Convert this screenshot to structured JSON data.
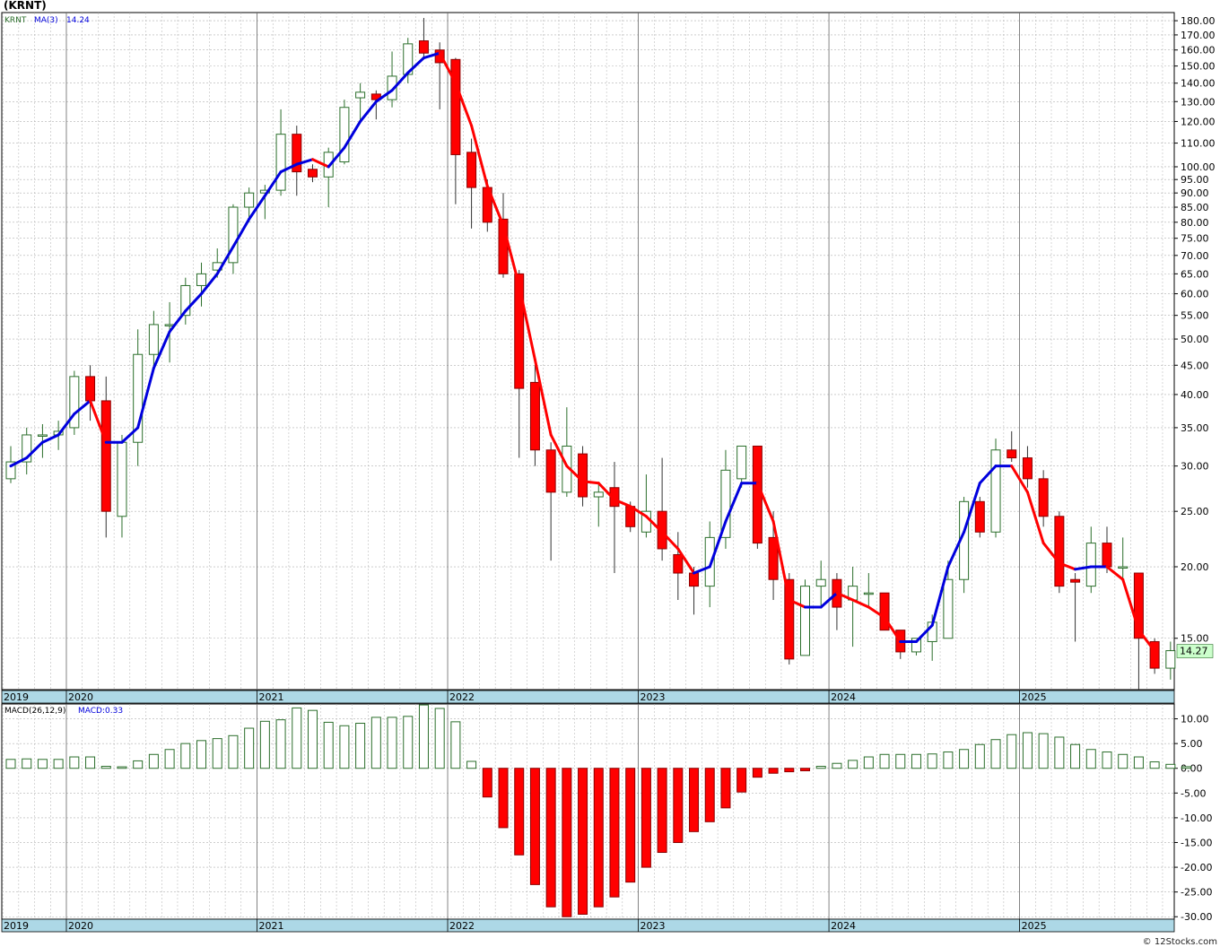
{
  "title": "(KRNT)",
  "credit": "© 12Stocks.com",
  "colors": {
    "up": "#2b6e2b",
    "down": "#ff0000",
    "ma_up": "#0000dd",
    "ma_down": "#ff0000",
    "axis_band": "#add8e6",
    "grid": "#b0b0b0"
  },
  "chart_data": [
    {
      "type": "candlestick",
      "legend": {
        "symbol": "KRNT",
        "ma_label": "MA(3)",
        "ma_value": "14.24"
      },
      "last_price_label": "14.27",
      "y_scale": "log",
      "y_ticks": [
        15,
        20,
        25,
        30,
        35,
        40,
        45,
        50,
        55,
        60,
        65,
        70,
        75,
        80,
        85,
        90,
        95,
        100,
        110,
        120,
        130,
        140,
        150,
        160,
        170,
        180
      ],
      "ylim": [
        12.2,
        186
      ],
      "x_labels": [
        "2019",
        "2020",
        "2021",
        "2022",
        "2023",
        "2024",
        "2025"
      ],
      "grid": true,
      "candles": [
        [
          28.5,
          30.5,
          32.5,
          28.0
        ],
        [
          30.5,
          34.0,
          35.0,
          29.0
        ],
        [
          34.0,
          34.0,
          35.5,
          31.0
        ],
        [
          34.0,
          34.5,
          36.0,
          32.0
        ],
        [
          35.0,
          43.0,
          44.0,
          34.0
        ],
        [
          43.0,
          39.0,
          45.0,
          36.0
        ],
        [
          39.0,
          25.0,
          43.0,
          22.5
        ],
        [
          24.5,
          33.0,
          34.0,
          22.5
        ],
        [
          33.0,
          47.0,
          52.0,
          30.0
        ],
        [
          47.0,
          53.0,
          56.0,
          44.0
        ],
        [
          53.0,
          53.0,
          58.0,
          45.5
        ],
        [
          55.0,
          62.0,
          64.0,
          53.0
        ],
        [
          62.0,
          65.0,
          68.0,
          57.0
        ],
        [
          66.0,
          68.0,
          72.0,
          64.0
        ],
        [
          68.0,
          85.0,
          86.0,
          65.0
        ],
        [
          85.0,
          90.0,
          92.0,
          80.0
        ],
        [
          90.0,
          91.0,
          93.0,
          81.0
        ],
        [
          91.0,
          114.0,
          126.0,
          89.0
        ],
        [
          114.0,
          98.0,
          118.0,
          89.0
        ],
        [
          99.0,
          96.0,
          101.0,
          94.0
        ],
        [
          96.0,
          106.0,
          108.0,
          85.0
        ],
        [
          102.0,
          127.0,
          131.0,
          101.0
        ],
        [
          132.0,
          135.0,
          140.0,
          120.0
        ],
        [
          134.0,
          131.0,
          136.0,
          121.0
        ],
        [
          131.0,
          144.0,
          159.0,
          127.0
        ],
        [
          145.0,
          164.0,
          168.0,
          140.0
        ],
        [
          166.0,
          158.0,
          182.0,
          154.0
        ],
        [
          160.0,
          152.0,
          165.0,
          126.0
        ],
        [
          154.0,
          105.0,
          155.0,
          86.0
        ],
        [
          106.0,
          92.0,
          112.0,
          78.0
        ],
        [
          92.0,
          80.0,
          95.0,
          77.0
        ],
        [
          81.0,
          65.0,
          90.0,
          64.0
        ],
        [
          65.0,
          41.0,
          66.0,
          31.0
        ],
        [
          42.0,
          32.0,
          45.0,
          30.0
        ],
        [
          32.0,
          27.0,
          33.0,
          20.5
        ],
        [
          27.0,
          32.5,
          38.0,
          26.5
        ],
        [
          31.5,
          26.5,
          32.5,
          25.5
        ],
        [
          26.5,
          27.0,
          28.0,
          23.5
        ],
        [
          27.5,
          25.5,
          30.5,
          19.5
        ],
        [
          25.5,
          23.5,
          26.0,
          23.0
        ],
        [
          23.0,
          25.0,
          29.0,
          22.5
        ],
        [
          25.0,
          21.5,
          31.0,
          20.5
        ],
        [
          21.0,
          19.5,
          23.0,
          17.5
        ],
        [
          19.5,
          18.5,
          20.0,
          16.5
        ],
        [
          18.5,
          22.5,
          24.0,
          17.0
        ],
        [
          22.5,
          29.5,
          32.0,
          21.5
        ],
        [
          28.5,
          32.5,
          32.5,
          27.5
        ],
        [
          32.5,
          22.0,
          32.5,
          21.5
        ],
        [
          22.5,
          19.0,
          25.0,
          17.5
        ],
        [
          19.0,
          13.8,
          19.5,
          13.5
        ],
        [
          14.0,
          18.5,
          19.0,
          14.0
        ],
        [
          18.5,
          19.0,
          20.5,
          17.0
        ],
        [
          19.0,
          17.0,
          19.5,
          15.5
        ],
        [
          17.5,
          18.5,
          20.0,
          14.5
        ],
        [
          18.0,
          18.0,
          19.5,
          17.0
        ],
        [
          18.0,
          15.5,
          18.0,
          15.5
        ],
        [
          15.5,
          14.2,
          15.5,
          13.8
        ],
        [
          14.2,
          15.0,
          15.0,
          14.0
        ],
        [
          14.8,
          16.0,
          16.5,
          13.7
        ],
        [
          15.0,
          19.0,
          20.5,
          17.0
        ],
        [
          19.0,
          26.0,
          26.5,
          18.0
        ],
        [
          26.0,
          23.0,
          26.5,
          22.5
        ],
        [
          23.0,
          32.0,
          33.5,
          22.5
        ],
        [
          32.0,
          31.0,
          34.5,
          30.5
        ],
        [
          31.0,
          28.5,
          32.5,
          27.5
        ],
        [
          28.5,
          24.5,
          29.5,
          23.5
        ],
        [
          24.5,
          18.5,
          25.0,
          18.0
        ],
        [
          19.0,
          18.8,
          19.5,
          14.8
        ],
        [
          18.5,
          22.0,
          23.5,
          18.0
        ],
        [
          22.0,
          20.0,
          23.5,
          19.5
        ],
        [
          20.0,
          20.0,
          22.5,
          19.0
        ],
        [
          19.5,
          15.0,
          19.5,
          12.0
        ],
        [
          14.8,
          13.3,
          15.0,
          13.0
        ],
        [
          13.3,
          14.27,
          14.8,
          12.7
        ]
      ],
      "ma3": [
        30.0,
        31.0,
        33.0,
        34.0,
        37.0,
        39.0,
        33.0,
        33.0,
        35.0,
        44.5,
        51.5,
        56.0,
        60.0,
        65.0,
        72.5,
        81.0,
        89.0,
        98.0,
        101.0,
        103.0,
        100.0,
        108.0,
        120.0,
        130.0,
        136.0,
        146.0,
        155.0,
        158.0,
        140.0,
        118.0,
        92.5,
        79.0,
        62.0,
        46.0,
        34.0,
        30.0,
        28.2,
        28.0,
        26.2,
        25.5,
        24.5,
        23.0,
        21.5,
        19.5,
        20.0,
        24.0,
        28.0,
        28.0,
        24.0,
        17.5,
        17.0,
        17.0,
        18.0,
        17.5,
        17.0,
        16.3,
        14.8,
        14.8,
        15.8,
        20.0,
        23.0,
        28.0,
        30.0,
        30.0,
        27.0,
        22.0,
        20.3,
        19.8,
        20.0,
        20.0,
        19.0,
        15.5,
        14.24
      ],
      "series": [
        {
          "name": "KRNT"
        },
        {
          "name": "MA(3)",
          "last": 14.24
        }
      ]
    },
    {
      "type": "bar",
      "legend": {
        "label": "MACD(26,12,9)",
        "macd_label": "MACD:0.33"
      },
      "y_ticks": [
        10,
        5,
        0,
        -5,
        -10,
        -15,
        -20,
        -25,
        -30
      ],
      "ylim": [
        -30.5,
        13
      ],
      "x_labels": [
        "2019",
        "2020",
        "2021",
        "2022",
        "2023",
        "2024",
        "2025"
      ],
      "grid": true,
      "values": [
        1.8,
        1.9,
        1.8,
        1.8,
        2.3,
        2.3,
        0.4,
        0.3,
        1.5,
        2.8,
        3.8,
        5.0,
        5.6,
        6.0,
        6.6,
        8.1,
        9.5,
        9.8,
        12.2,
        11.7,
        9.3,
        8.6,
        9.1,
        10.3,
        10.3,
        10.5,
        12.8,
        12.1,
        9.4,
        1.4,
        -5.8,
        -12.0,
        -17.5,
        -23.5,
        -28.0,
        -30.0,
        -29.5,
        -28.0,
        -26.0,
        -23.0,
        -20.0,
        -17.0,
        -15.0,
        -12.8,
        -10.8,
        -8.0,
        -4.8,
        -1.8,
        -1.0,
        -0.7,
        -0.5,
        0.4,
        1.0,
        1.6,
        2.3,
        2.8,
        2.8,
        2.8,
        2.9,
        3.3,
        3.8,
        4.8,
        5.8,
        6.8,
        7.2,
        7.0,
        6.3,
        4.8,
        3.8,
        3.3,
        2.8,
        2.3,
        1.3,
        0.8,
        0.33
      ]
    }
  ]
}
